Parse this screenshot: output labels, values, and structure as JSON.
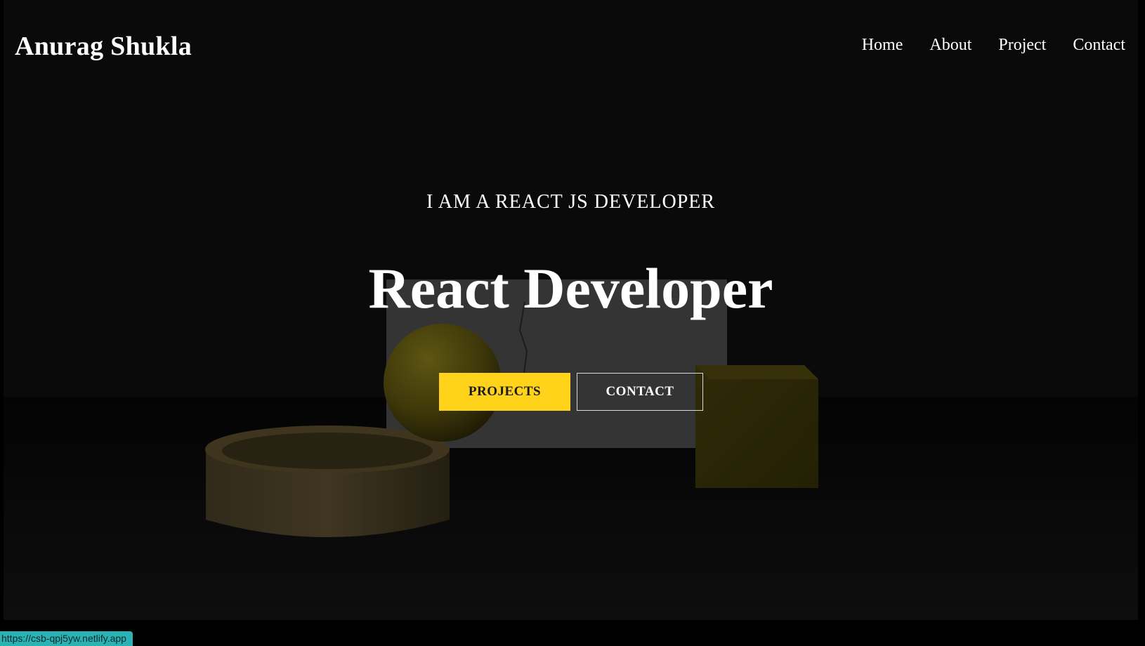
{
  "brand": {
    "name": "Anurag Shukla"
  },
  "nav": {
    "items": [
      {
        "label": "Home"
      },
      {
        "label": "About"
      },
      {
        "label": "Project"
      },
      {
        "label": "Contact"
      }
    ]
  },
  "hero": {
    "eyebrow": "I AM A REACT JS DEVELOPER",
    "title": "React Developer",
    "primary_button": "PROJECTS",
    "secondary_button": "CONTACT"
  },
  "status_bar": {
    "url": "https://csb-qpj5yw.netlify.app"
  },
  "colors": {
    "accent": "#ffd31a",
    "background": "#0b0b0b",
    "status_bg": "#2ab2b4"
  }
}
